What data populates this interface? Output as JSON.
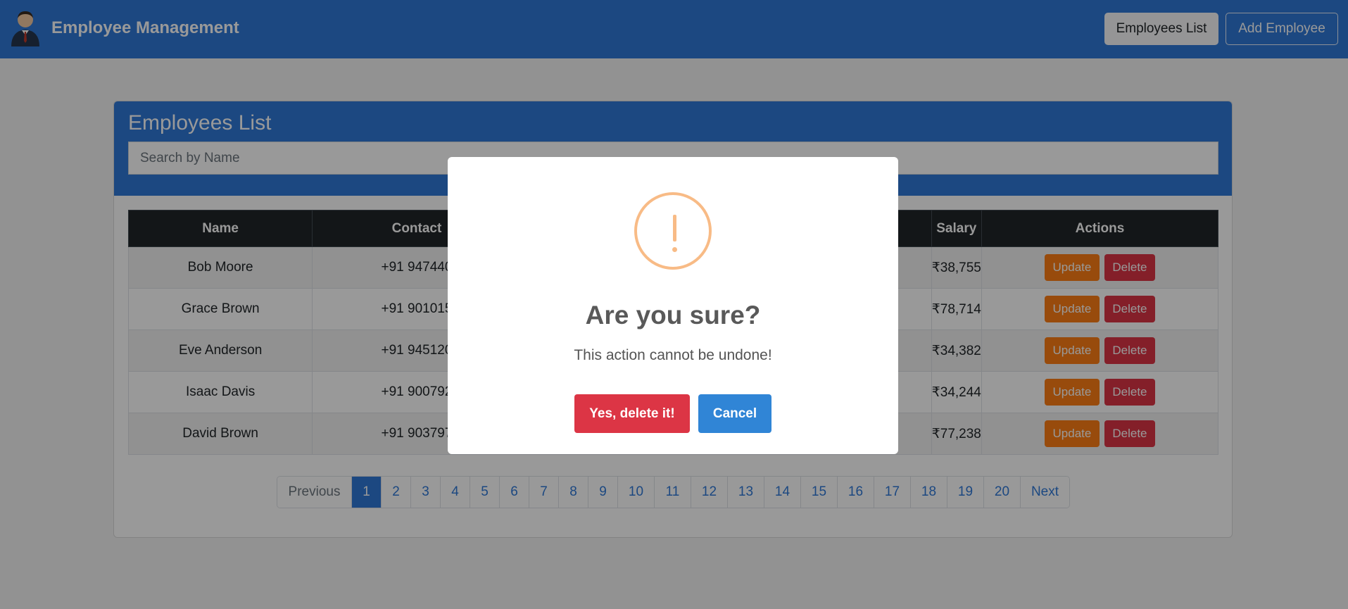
{
  "navbar": {
    "brand": "Employee Management",
    "employees_list": "Employees List",
    "add_employee": "Add Employee"
  },
  "card": {
    "title": "Employees List",
    "search_placeholder": "Search by Name"
  },
  "table": {
    "headers": {
      "name": "Name",
      "contact": "Contact",
      "salary": "Salary",
      "actions": "Actions"
    },
    "rows": [
      {
        "name": "Bob Moore",
        "contact": "+91 947440",
        "salary": "₹38,755"
      },
      {
        "name": "Grace Brown",
        "contact": "+91 901015",
        "salary": "₹78,714"
      },
      {
        "name": "Eve Anderson",
        "contact": "+91 945120",
        "salary": "₹34,382"
      },
      {
        "name": "Isaac Davis",
        "contact": "+91 900792",
        "salary": "₹34,244"
      },
      {
        "name": "David Brown",
        "contact": "+91 903797",
        "salary": "₹77,238"
      }
    ],
    "update_label": "Update",
    "delete_label": "Delete"
  },
  "pagination": {
    "previous": "Previous",
    "next": "Next",
    "pages": [
      "1",
      "2",
      "3",
      "4",
      "5",
      "6",
      "7",
      "8",
      "9",
      "10",
      "11",
      "12",
      "13",
      "14",
      "15",
      "16",
      "17",
      "18",
      "19",
      "20"
    ],
    "active": "1"
  },
  "modal": {
    "icon": "warning-icon",
    "title": "Are you sure?",
    "text": "This action cannot be undone!",
    "confirm": "Yes, delete it!",
    "cancel": "Cancel"
  },
  "colors": {
    "primary": "#2f79d8",
    "danger": "#dc3545",
    "warning": "#fd7e14",
    "confirm_blue": "#3085d6"
  }
}
